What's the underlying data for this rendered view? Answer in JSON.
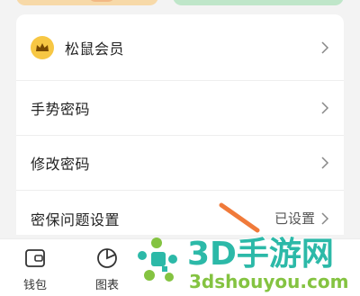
{
  "menu": {
    "items": [
      {
        "label": "松鼠会员",
        "value": ""
      },
      {
        "label": "手势密码",
        "value": ""
      },
      {
        "label": "修改密码",
        "value": ""
      },
      {
        "label": "密保问题设置",
        "value": "已设置"
      }
    ]
  },
  "bottom_nav": {
    "wallet_label": "钱包",
    "chart_label": "图表"
  },
  "watermark": {
    "title": "3D手游网",
    "url": "3dshouyou.com"
  },
  "colors": {
    "crown": "#f7c744",
    "watermark_teal": "#2cb9a8",
    "watermark_green": "#84c341",
    "arrow": "#f07a3a"
  }
}
